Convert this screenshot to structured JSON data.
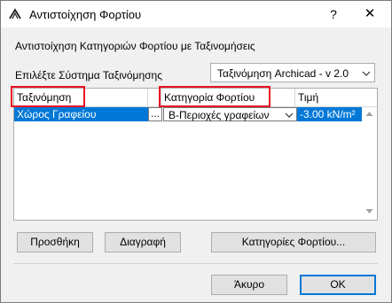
{
  "window": {
    "title": "Αντιστοίχηση Φορτίου",
    "help_label": "?",
    "close_label": "✕"
  },
  "section_label": "Αντιστοίχηση Κατηγοριών Φορτίου με Ταξινομήσεις",
  "system": {
    "label": "Επιλέξτε Σύστημα Ταξινόμησης",
    "selected": "Ταξινόμηση Archicad - v 2.0"
  },
  "table": {
    "headers": [
      "Ταξινόμηση",
      "Κατηγορία Φορτίου",
      "Τιμή"
    ],
    "rows": [
      {
        "classification": "Χώρος Γραφείου",
        "ellipsis": "...",
        "category": "Β-Περιοχές γραφείων",
        "value": "-3.00 kN/m²"
      }
    ]
  },
  "buttons": {
    "add": "Προσθήκη",
    "delete": "Διαγραφή",
    "categories": "Κατηγορίες Φορτίου...",
    "cancel": "Άκυρο",
    "ok": "OK"
  },
  "colors": {
    "selection": "#0078d7",
    "annotation_box": "#e81123"
  }
}
